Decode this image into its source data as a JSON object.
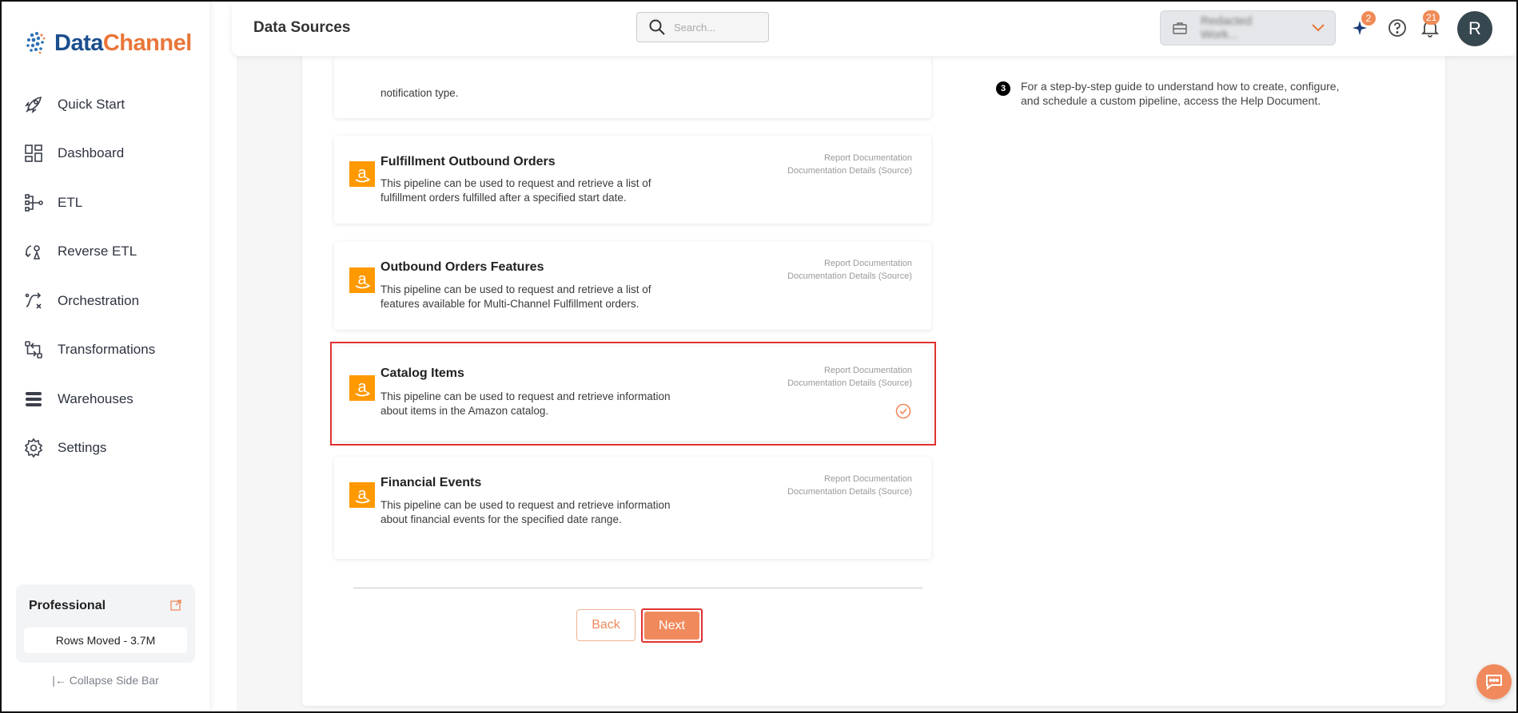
{
  "brand": {
    "name_part1": "Data",
    "name_part2": "Channel"
  },
  "sidebar": {
    "items": [
      {
        "label": "Quick Start",
        "icon": "rocket-icon"
      },
      {
        "label": "Dashboard",
        "icon": "dashboard-icon"
      },
      {
        "label": "ETL",
        "icon": "etl-icon"
      },
      {
        "label": "Reverse ETL",
        "icon": "reverse-etl-icon"
      },
      {
        "label": "Orchestration",
        "icon": "orchestration-icon"
      },
      {
        "label": "Transformations",
        "icon": "transformations-icon"
      },
      {
        "label": "Warehouses",
        "icon": "warehouses-icon"
      },
      {
        "label": "Settings",
        "icon": "gear-icon"
      }
    ],
    "plan": {
      "name": "Professional",
      "rows_moved": "Rows Moved - 3.7M"
    },
    "collapse_label": "|← Collapse Side Bar"
  },
  "header": {
    "title": "Data Sources",
    "search_placeholder": "Search...",
    "workspace_name": "Redacted Work...",
    "ai_badge": "2",
    "notification_badge": "21",
    "avatar_initial": "R"
  },
  "pipelines": {
    "partial_top_desc": "notification type.",
    "cards": [
      {
        "title": "Fulfillment Outbound Orders",
        "desc": "This pipeline can be used to request and retrieve a list of fulfillment orders fulfilled after a specified start date.",
        "link1": "Report Documentation",
        "link2": "Documentation Details (Source)"
      },
      {
        "title": "Outbound Orders Features",
        "desc": "This pipeline can be used to request and retrieve a list of features available for Multi-Channel Fulfillment orders.",
        "link1": "Report Documentation",
        "link2": "Documentation Details (Source)"
      },
      {
        "title": "Catalog Items",
        "desc": "This pipeline can be used to request and retrieve information about items in the Amazon catalog.",
        "link1": "Report Documentation",
        "link2": "Documentation Details (Source)",
        "selected": true
      },
      {
        "title": "Financial Events",
        "desc": "This pipeline can be used to request and retrieve information about financial events for the specified date range.",
        "link1": "Report Documentation",
        "link2": "Documentation Details (Source)"
      }
    ]
  },
  "actions": {
    "back": "Back",
    "next": "Next"
  },
  "help": {
    "step": "3",
    "text": "For a step-by-step guide to understand how to create, configure, and schedule a custom pipeline, access the Help Document."
  },
  "colors": {
    "accent": "#f08a5d",
    "brand_blue": "#1a4f8e",
    "amazon": "#ff9900",
    "highlight": "#e03131"
  }
}
